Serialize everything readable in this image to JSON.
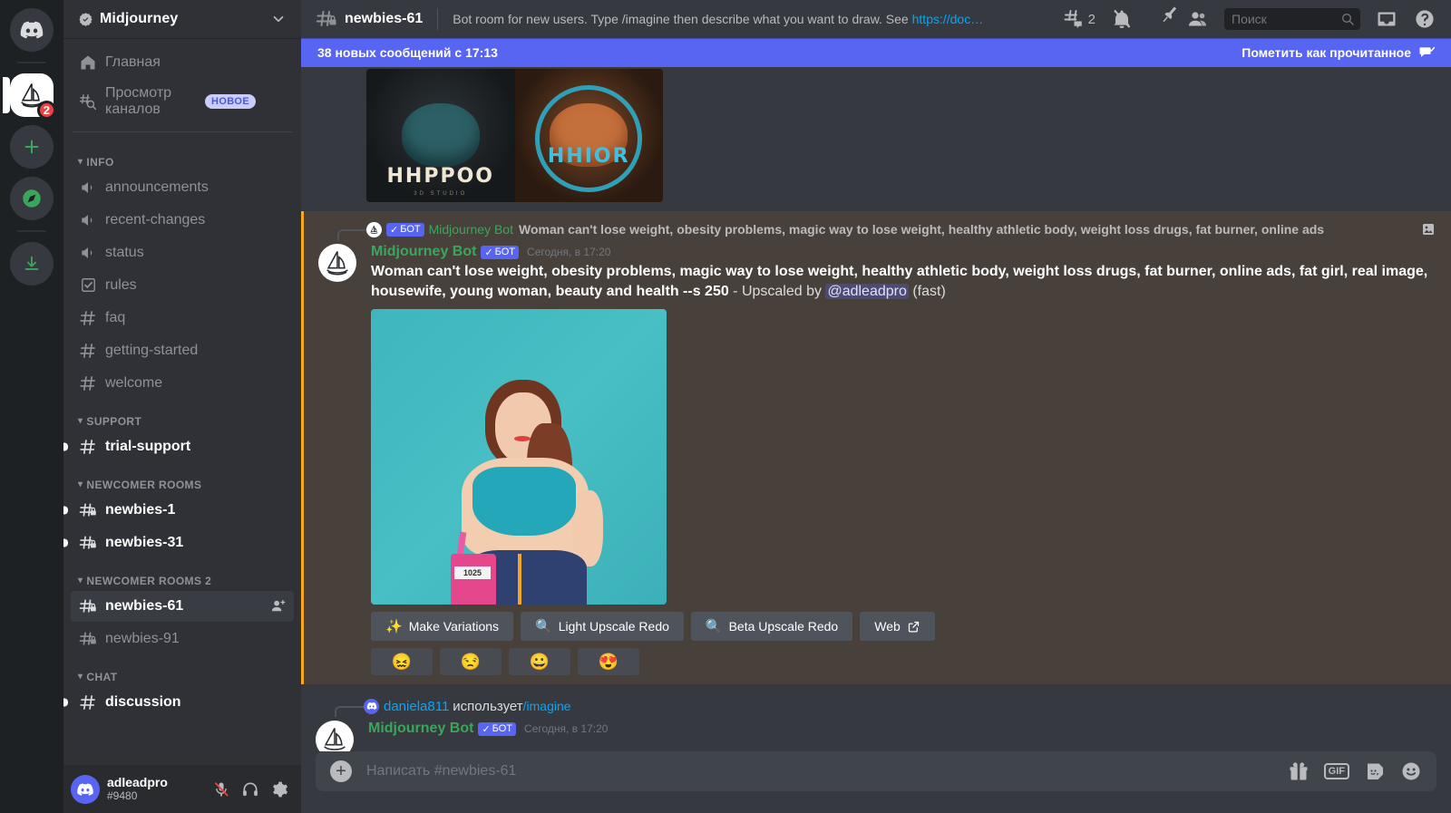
{
  "server_rail": {
    "home_icon": "discord-logo-icon",
    "servers": [
      {
        "name": "Midjourney",
        "icon": "sailboat-icon",
        "badge": "2",
        "active": true
      }
    ],
    "add_server_label": "+",
    "explore_icon": "compass-icon",
    "download_icon": "download-icon"
  },
  "sidebar": {
    "server_name": "Midjourney",
    "verified_icon": "verified-check-icon",
    "chevron_icon": "chevron-down-icon",
    "nav": [
      {
        "label": "Главная",
        "icon": "home-icon"
      },
      {
        "label": "Просмотр каналов",
        "icon": "browse-channels-icon",
        "badge": "НОВОЕ"
      }
    ],
    "categories": [
      {
        "name": "INFO",
        "channels": [
          {
            "label": "announcements",
            "icon": "announcement-icon",
            "state": "normal"
          },
          {
            "label": "recent-changes",
            "icon": "announcement-icon",
            "state": "normal"
          },
          {
            "label": "status",
            "icon": "announcement-icon",
            "state": "normal"
          },
          {
            "label": "rules",
            "icon": "rules-icon",
            "state": "normal"
          },
          {
            "label": "faq",
            "icon": "hash-icon",
            "state": "normal"
          },
          {
            "label": "getting-started",
            "icon": "hash-icon",
            "state": "normal"
          },
          {
            "label": "welcome",
            "icon": "hash-icon",
            "state": "normal"
          }
        ]
      },
      {
        "name": "SUPPORT",
        "channels": [
          {
            "label": "trial-support",
            "icon": "hash-icon",
            "state": "unread"
          }
        ]
      },
      {
        "name": "NEWCOMER ROOMS",
        "channels": [
          {
            "label": "newbies-1",
            "icon": "hash-lock-icon",
            "state": "unread"
          },
          {
            "label": "newbies-31",
            "icon": "hash-lock-icon",
            "state": "unread"
          }
        ]
      },
      {
        "name": "NEWCOMER ROOMS 2",
        "channels": [
          {
            "label": "newbies-61",
            "icon": "hash-lock-icon",
            "state": "selected",
            "action_icon": "add-member-icon"
          },
          {
            "label": "newbies-91",
            "icon": "hash-lock-icon",
            "state": "normal"
          }
        ]
      },
      {
        "name": "CHAT",
        "channels": [
          {
            "label": "discussion",
            "icon": "hash-icon",
            "state": "unread"
          }
        ]
      }
    ],
    "user_panel": {
      "avatar_icon": "discord-avatar-icon",
      "username": "adleadpro",
      "discriminator": "#9480",
      "mute_icon": "microphone-muted-icon",
      "deafen_icon": "headphones-icon",
      "settings_icon": "gear-icon"
    }
  },
  "channel_header": {
    "hash_icon": "hash-lock-icon",
    "channel_name": "newbies-61",
    "topic_prefix": "Bot room for new users. Type /imagine then describe what you want to draw. See ",
    "topic_link": "https://doc…",
    "threads_icon": "threads-icon",
    "threads_count": "2",
    "notifications_icon": "bell-muted-icon",
    "pins_icon": "pin-icon",
    "members_icon": "members-icon",
    "search": {
      "placeholder": "Поиск",
      "icon": "search-icon"
    },
    "inbox_icon": "inbox-icon",
    "help_icon": "help-icon"
  },
  "new_messages_banner": {
    "text": "38 новых сообщений с 17:13",
    "mark_read_label": "Пометить как прочитанное",
    "mark_read_icon": "mark-read-icon",
    "color": "#5865f2"
  },
  "messages": {
    "top_attachment": {
      "name": "hippo-logo-pair-image",
      "left_text": "HHPPOO",
      "left_subtext": "3D STUDIO",
      "right_text": "HHIOR"
    },
    "highlighted": {
      "accent_color": "#faa81a",
      "background_color": "#48413b",
      "reply_preview": {
        "avatar_icon": "sailboat-avatar-icon",
        "bot_tag": "БОТ",
        "author": "Midjourney Bot",
        "text": "Woman can't lose weight, obesity problems, magic way to lose weight, healthy athletic body, weight loss drugs, fat burner, online ads",
        "attachment_icon": "image-attachment-icon"
      },
      "author": "Midjourney Bot",
      "bot_tag": "БОТ",
      "timestamp": "Сегодня, в 17:20",
      "prompt": "Woman can't lose weight, obesity problems, magic way to lose weight, healthy athletic body, weight loss drugs, fat burner, online ads, fat girl, real image, housewife, young woman, beauty and health --s 250",
      "upscale_text": " - Upscaled by ",
      "mention": "@adleadpro",
      "speed_note": " (fast)",
      "attachment_name": "generated-plus-size-woman-image",
      "action_buttons": [
        {
          "label": "Make Variations",
          "icon": "sparkles-icon"
        },
        {
          "label": "Light Upscale Redo",
          "icon": "magnifier-icon"
        },
        {
          "label": "Beta Upscale Redo",
          "icon": "magnifier-icon"
        },
        {
          "label": "Web",
          "icon": "external-link-icon"
        }
      ],
      "reactions": [
        {
          "emoji": "😖",
          "name": "confounded-face-reaction"
        },
        {
          "emoji": "😒",
          "name": "unamused-face-reaction"
        },
        {
          "emoji": "😀",
          "name": "grinning-face-reaction"
        },
        {
          "emoji": "😍",
          "name": "heart-eyes-face-reaction"
        }
      ]
    },
    "next": {
      "reply_avatar_icon": "discord-avatar-icon",
      "reply_author": "daniela811",
      "reply_action": " использует ",
      "reply_command": "/imagine",
      "author": "Midjourney Bot",
      "bot_tag": "БОТ",
      "timestamp": "Сегодня, в 17:20"
    }
  },
  "composer": {
    "plus_icon": "add-attachment-icon",
    "placeholder": "Написать #newbies-61",
    "gift_icon": "gift-icon",
    "gif_label": "GIF",
    "sticker_icon": "sticker-icon",
    "emoji_icon": "emoji-icon"
  }
}
